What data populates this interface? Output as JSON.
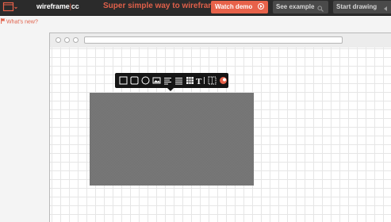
{
  "topbar": {
    "logo_main": "wireframe",
    "logo_sep": "|",
    "logo_tld": "cc",
    "tagline": "Super simple way to wireframe",
    "watch_demo_label": "Watch demo",
    "see_example_label": "See example",
    "start_drawing_label": "Start drawing",
    "accent_color": "#e8624a",
    "menu_icon": "window-menu-icon"
  },
  "whats_new": {
    "label": "What's new?",
    "icon": "flag-icon"
  },
  "toolbar": {
    "tools": [
      "box-tool-icon",
      "rounded-box-tool-icon",
      "circle-tool-icon",
      "image-tool-icon",
      "paragraph-tool-icon",
      "list-tool-icon",
      "table-tool-icon",
      "text-tool-icon",
      "dotted-box-tool-icon",
      "color-tool-icon"
    ],
    "text_tool_glyph": "T"
  }
}
